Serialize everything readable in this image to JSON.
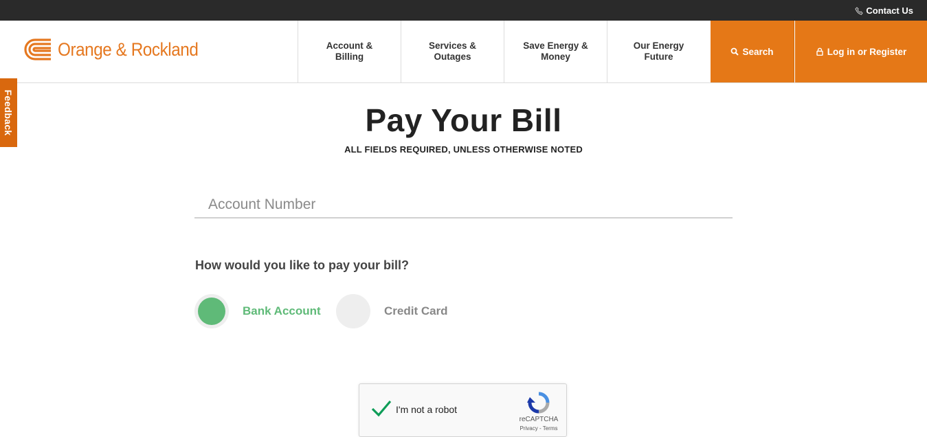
{
  "topbar": {
    "contact_label": "Contact Us",
    "contact_icon": "phone-icon"
  },
  "header": {
    "logo_text": "Orange & Rockland",
    "nav": [
      {
        "line1": "Account &",
        "line2": "Billing"
      },
      {
        "line1": "Services &",
        "line2": "Outages"
      },
      {
        "line1": "Save Energy &",
        "line2": "Money"
      },
      {
        "line1": "Our Energy",
        "line2": "Future"
      }
    ],
    "search_label": "Search",
    "login_label": "Log in or Register"
  },
  "feedback_label": "Feedback",
  "main": {
    "title": "Pay Your Bill",
    "subtitle": "ALL FIELDS REQUIRED, UNLESS OTHERWISE NOTED",
    "account_placeholder": "Account Number",
    "question": "How would you like to pay your bill?",
    "options": [
      {
        "label": "Bank Account",
        "selected": true
      },
      {
        "label": "Credit Card",
        "selected": false
      }
    ]
  },
  "captcha": {
    "label": "I'm not a robot",
    "brand": "reCAPTCHA",
    "privacy": "Privacy",
    "separator": " - ",
    "terms": "Terms",
    "checked": true
  },
  "colors": {
    "brand_orange": "#e57817",
    "selected_green": "#5fba78",
    "topbar_bg": "#2a2a2a"
  }
}
